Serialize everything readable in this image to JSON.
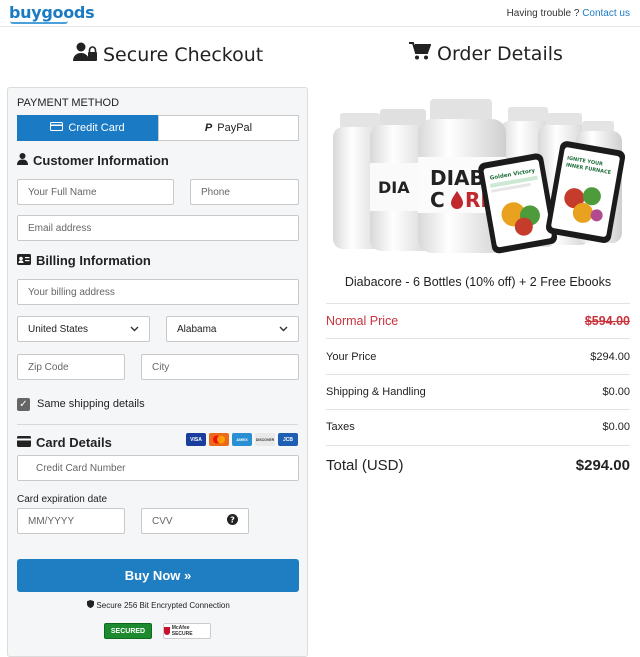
{
  "brand": {
    "logo": "buygoods"
  },
  "header": {
    "help_text": "Having trouble ?",
    "contact_link": "Contact us"
  },
  "left": {
    "heading": "Secure Checkout",
    "payment_method_label": "PAYMENT METHOD",
    "tabs": {
      "credit_card": "Credit Card",
      "paypal": "PayPal"
    },
    "customer_info_heading": "Customer Information",
    "full_name_placeholder": "Your Full Name",
    "phone_placeholder": "Phone",
    "email_placeholder": "Email address",
    "billing_info_heading": "Billing Information",
    "billing_address_placeholder": "Your billing address",
    "country_value": "United States",
    "state_value": "Alabama",
    "zip_placeholder": "Zip Code",
    "city_placeholder": "City",
    "same_shipping_label": "Same shipping details",
    "card_details_heading": "Card Details",
    "card_brands": [
      "VISA",
      "MC",
      "AMEX",
      "DISCOVER",
      "JCB"
    ],
    "card_number_placeholder": "Credit Card Number",
    "expiration_label": "Card expiration date",
    "expiry_placeholder": "MM/YYYY",
    "cvv_placeholder": "CVV",
    "buy_button": "Buy Now »",
    "secure_note": "Secure 256 Bit Encrypted Connection",
    "badges": {
      "secured": "SECURED",
      "mcafee": "McAfee SECURE"
    }
  },
  "right": {
    "heading": "Order Details",
    "product_title": "Diabacore - 6 Bottles (10% off) + 2 Free Ebooks",
    "product_brand_text": "DIABA CORE",
    "ebook_1": "Golden Victory",
    "ebook_2": "IGNITE YOUR INNER FURNACE",
    "rows": {
      "normal_price_label": "Normal Price",
      "normal_price_value": "$594.00",
      "your_price_label": "Your Price",
      "your_price_value": "$294.00",
      "shipping_label": "Shipping & Handling",
      "shipping_value": "$0.00",
      "taxes_label": "Taxes",
      "taxes_value": "$0.00",
      "total_label": "Total (USD)",
      "total_value": "$294.00"
    }
  },
  "colors": {
    "accent": "#1a7bc4",
    "normal_price": "#c8343d"
  }
}
